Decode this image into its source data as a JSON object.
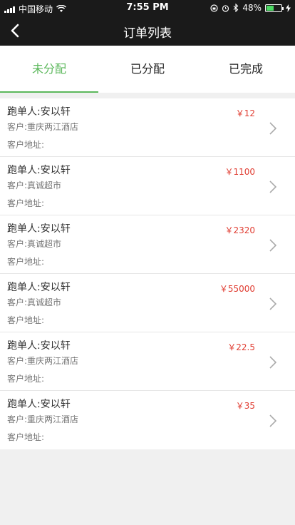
{
  "status_bar": {
    "carrier": "中国移动",
    "time": "7:55 PM",
    "battery_percent": "48%",
    "battery_level": 0.48,
    "icons": [
      "signal-icon",
      "wifi-icon",
      "lock-rotation-icon",
      "alarm-icon",
      "bluetooth-icon",
      "battery-icon",
      "charging-icon"
    ]
  },
  "nav": {
    "title": "订单列表",
    "back_icon": "chevron-left-icon"
  },
  "tabs": [
    {
      "label": "未分配",
      "active": true
    },
    {
      "label": "已分配",
      "active": false
    },
    {
      "label": "已完成",
      "active": false
    }
  ],
  "orders": [
    {
      "runner": "跑单人:安以轩",
      "customer": "客户:重庆两江酒店",
      "address": "客户地址:",
      "amount": "￥12"
    },
    {
      "runner": "跑单人:安以轩",
      "customer": "客户:真诚超市",
      "address": "客户地址:",
      "amount": "￥1100"
    },
    {
      "runner": "跑单人:安以轩",
      "customer": "客户:真诚超市",
      "address": "客户地址:",
      "amount": "￥2320"
    },
    {
      "runner": "跑单人:安以轩",
      "customer": "客户:真诚超市",
      "address": "客户地址:",
      "amount": "￥55000"
    },
    {
      "runner": "跑单人:安以轩",
      "customer": "客户:重庆两江酒店",
      "address": "客户地址:",
      "amount": "￥22.5"
    },
    {
      "runner": "跑单人:安以轩",
      "customer": "客户:重庆两江酒店",
      "address": "客户地址:",
      "amount": "￥35"
    }
  ],
  "colors": {
    "accent_green": "#5cb85c",
    "amount_red": "#e03c31",
    "header_bg": "#1a1a1a",
    "page_bg": "#f0f0f0"
  }
}
